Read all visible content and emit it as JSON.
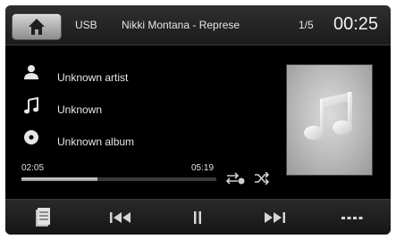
{
  "topbar": {
    "source": "USB",
    "track_title": "Nikki Montana - Represe",
    "track_count": "1/5",
    "clock": "00:25"
  },
  "info": {
    "artist": "Unknown artist",
    "title": "Unknown",
    "album": "Unknown album"
  },
  "progress": {
    "elapsed": "02:05",
    "total": "05:19",
    "fraction": 0.39
  },
  "colors": {
    "background": "#000000",
    "text": "#e8e8e8",
    "accent": "#d8d8d8"
  },
  "controls": [
    "list-icon",
    "previous-icon",
    "pause-icon",
    "next-icon",
    "more-icon"
  ]
}
